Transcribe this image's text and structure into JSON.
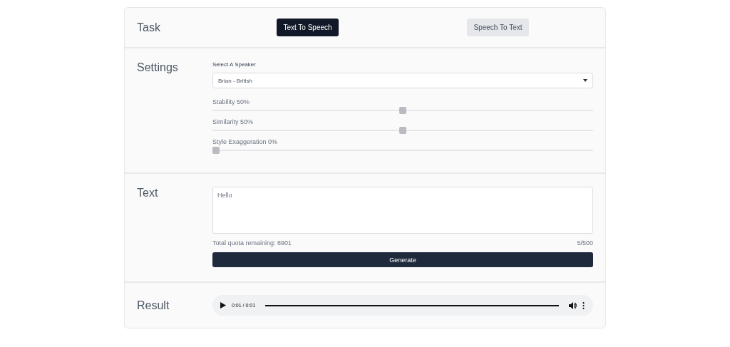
{
  "task": {
    "heading": "Task",
    "tabs": [
      {
        "label": "Text To Speech",
        "selected": true
      },
      {
        "label": "Speech To Text",
        "selected": false
      }
    ]
  },
  "settings": {
    "heading": "Settings",
    "speaker_label": "Select A Speaker",
    "speaker_value": "Brian - British",
    "sliders": [
      {
        "label": "Stability 50%",
        "level": 0.5
      },
      {
        "label": "Similarity 50%",
        "level": 0.5
      },
      {
        "label": "Style Exaggeration 0%",
        "level": 0
      }
    ]
  },
  "text": {
    "heading": "Text",
    "value": "Hello",
    "quota": "Total quota remaining: 8901",
    "count": "5/500",
    "button": "Generate"
  },
  "result": {
    "heading": "Result",
    "time": "0:01 / 0:01",
    "level": 1
  }
}
